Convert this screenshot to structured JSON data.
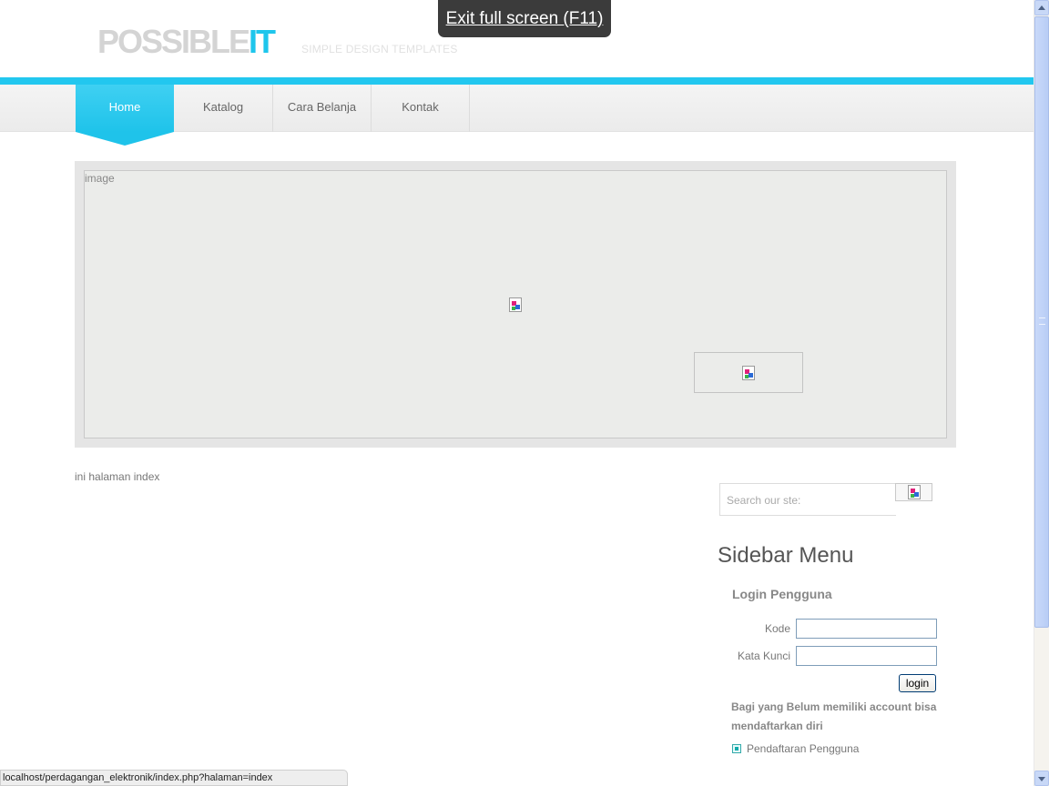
{
  "header": {
    "logo_part1": "POSSIBLE",
    "logo_part2": "IT",
    "tagline": "SIMPLE DESIGN TEMPLATES"
  },
  "fullscreen_tip": "Exit full screen (F11)",
  "nav": [
    {
      "label": "Home",
      "active": true
    },
    {
      "label": "Katalog"
    },
    {
      "label": "Cara Belanja"
    },
    {
      "label": "Kontak"
    }
  ],
  "banner": {
    "alt_text": "image"
  },
  "content": {
    "text": "ini halaman index"
  },
  "sidebar": {
    "search_placeholder": "Search our ste:",
    "title": "Sidebar Menu",
    "login": {
      "title": "Login Pengguna",
      "kode_label": "Kode",
      "kode_value": "",
      "kunci_label": "Kata Kunci",
      "kunci_value": "",
      "button": "login"
    },
    "register_note": "Bagi yang Belum memiliki account bisa mendaftarkan diri",
    "register_link": "Pendaftaran Pengguna"
  },
  "statusbar": {
    "url": "localhost/perdagangan_elektronik/index.php?halaman=index"
  },
  "colors": {
    "accent": "#22c7ef",
    "logo_gray": "#d4d4d4"
  }
}
